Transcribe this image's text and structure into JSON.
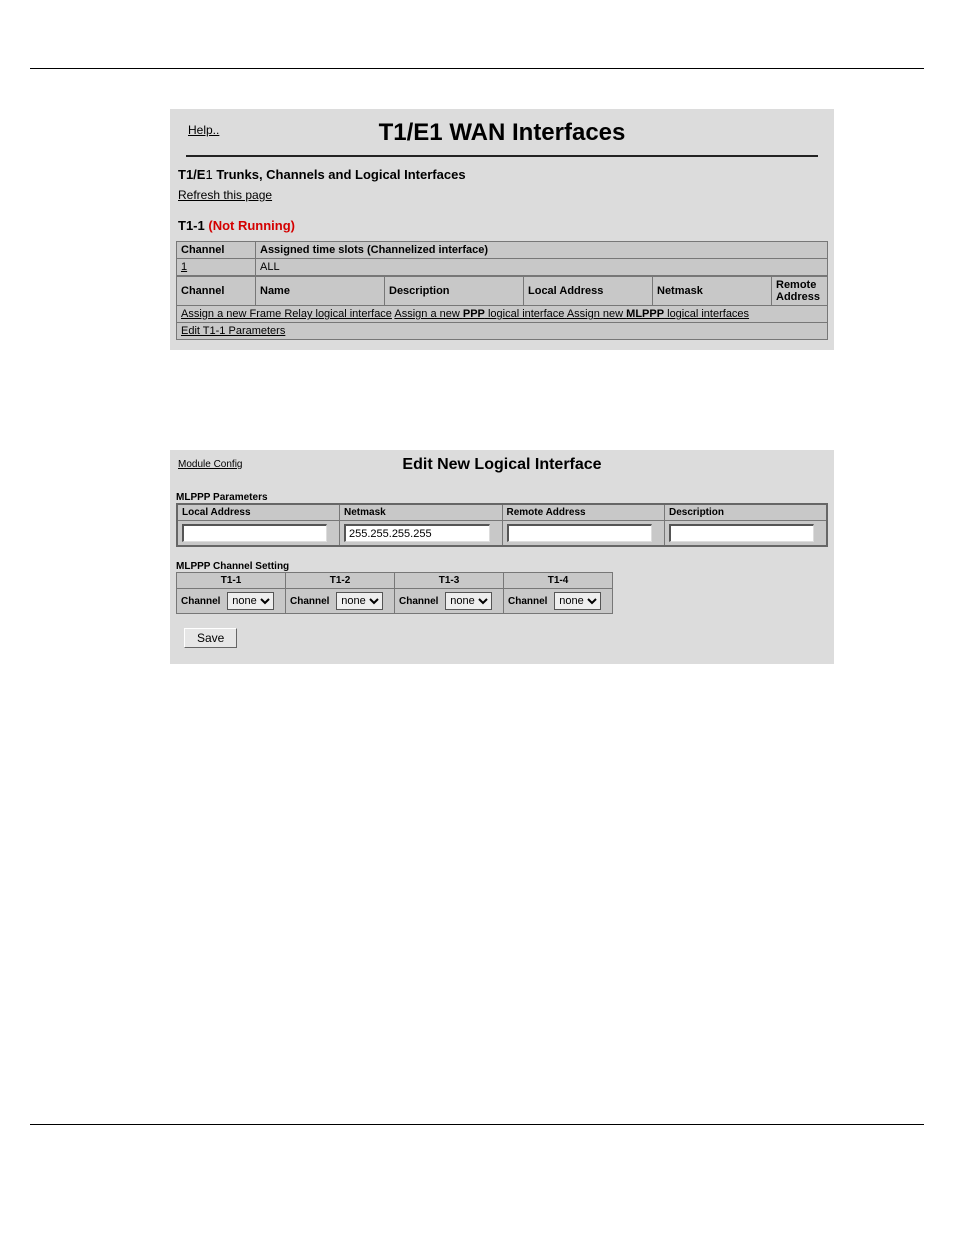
{
  "top": {
    "help": "Help..",
    "title": "T1/E1 WAN Interfaces",
    "section_title_pre": "T1/E",
    "section_title_e1": "1",
    "section_title_post": " Trunks, Channels and Logical Interfaces",
    "refresh": "Refresh this page",
    "trunk_id": "T1-1",
    "trunk_status": "(Not Running)",
    "table1": {
      "channel_hdr": "Channel",
      "slots_hdr": "Assigned time slots (Channelized interface)",
      "row_channel": "1",
      "row_slots": "ALL"
    },
    "table2": {
      "channel_hdr": "Channel",
      "name_hdr": "Name",
      "desc_hdr": "Description",
      "local_hdr": "Local Address",
      "netmask_hdr": "Netmask",
      "remote_hdr": "Remote Address",
      "assign_pre": "Assign a new Frame Relay logical interface",
      "assign_ppp_pre": "Assign a new ",
      "assign_ppp_strong": "PPP",
      "assign_ppp_post": " logical interface",
      "assign_mlppp_pre": "Assign new ",
      "assign_mlppp_strong": "MLPPP",
      "assign_mlppp_post": " logical interfaces",
      "edit_params": "Edit T1-1 Parameters"
    }
  },
  "bottom": {
    "module_config": "Module Config",
    "title": "Edit New Logical Interface",
    "params_header": "MLPPP Parameters",
    "cols": {
      "local": "Local Address",
      "netmask": "Netmask",
      "remote": "Remote Address",
      "desc": "Description"
    },
    "values": {
      "local": "",
      "netmask": "255.255.255.255",
      "remote": "",
      "desc": ""
    },
    "chset_header": "MLPPP Channel Setting",
    "channel_label": "Channel",
    "trunks": [
      "T1-1",
      "T1-2",
      "T1-3",
      "T1-4"
    ],
    "dropdown_value": "none",
    "save": "Save"
  }
}
